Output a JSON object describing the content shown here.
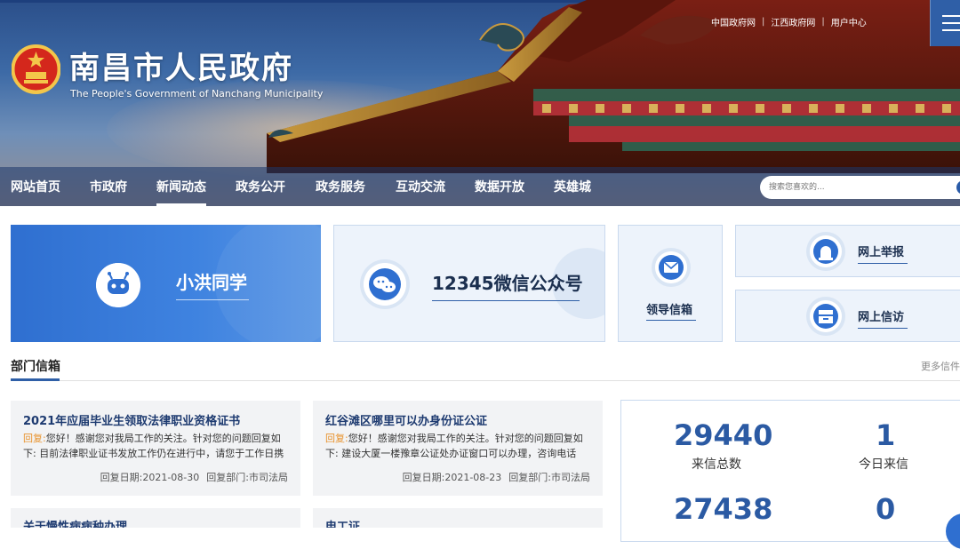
{
  "header": {
    "title": "南昌市人民政府",
    "subtitle": "The People's Government of Nanchang Municipality",
    "top_links": [
      "中国政府网",
      "江西政府网",
      "用户中心"
    ]
  },
  "nav": {
    "items": [
      "网站首页",
      "市政府",
      "新闻动态",
      "政务公开",
      "政务服务",
      "互动交流",
      "数据开放",
      "英雄城"
    ],
    "active": "新闻动态",
    "search_placeholder": "搜索您喜欢的..."
  },
  "cards": {
    "xiaohong": "小洪同学",
    "wechat": "12345微信公众号",
    "leader_mailbox": "领导信箱",
    "report": "网上举报",
    "petition": "网上信访"
  },
  "section": {
    "title": "部门信箱",
    "more": "更多信件"
  },
  "letters": [
    {
      "title": "2021年应届毕业生领取法律职业资格证书",
      "reply_label": "回复:",
      "reply_text": "您好！感谢您对我局工作的关注。针对您的问题回复如下: 目前法律职业证书发放工作仍在进行中，请您于工作日携",
      "date_label": "回复日期:2021-08-30",
      "dept_label": "回复部门:市司法局"
    },
    {
      "title": "红谷滩区哪里可以办身份证公证",
      "reply_label": "回复:",
      "reply_text": "您好！感谢您对我局工作的关注。针对您的问题回复如下: 建设大厦一楼豫章公证处办证窗口可以办理，咨询电话",
      "date_label": "回复日期:2021-08-23",
      "dept_label": "回复部门:市司法局"
    },
    {
      "title": "关于慢性病病种办理"
    },
    {
      "title": "电工证"
    }
  ],
  "stats": {
    "total_letters": "29440",
    "total_letters_label": "来信总数",
    "today_letters": "1",
    "today_letters_label": "今日来信",
    "replied": "27438",
    "pending": "0"
  },
  "colors": {
    "primary": "#2f5fa7",
    "accent_reply": "#e8922c",
    "card_blue": "#3f83e0"
  }
}
